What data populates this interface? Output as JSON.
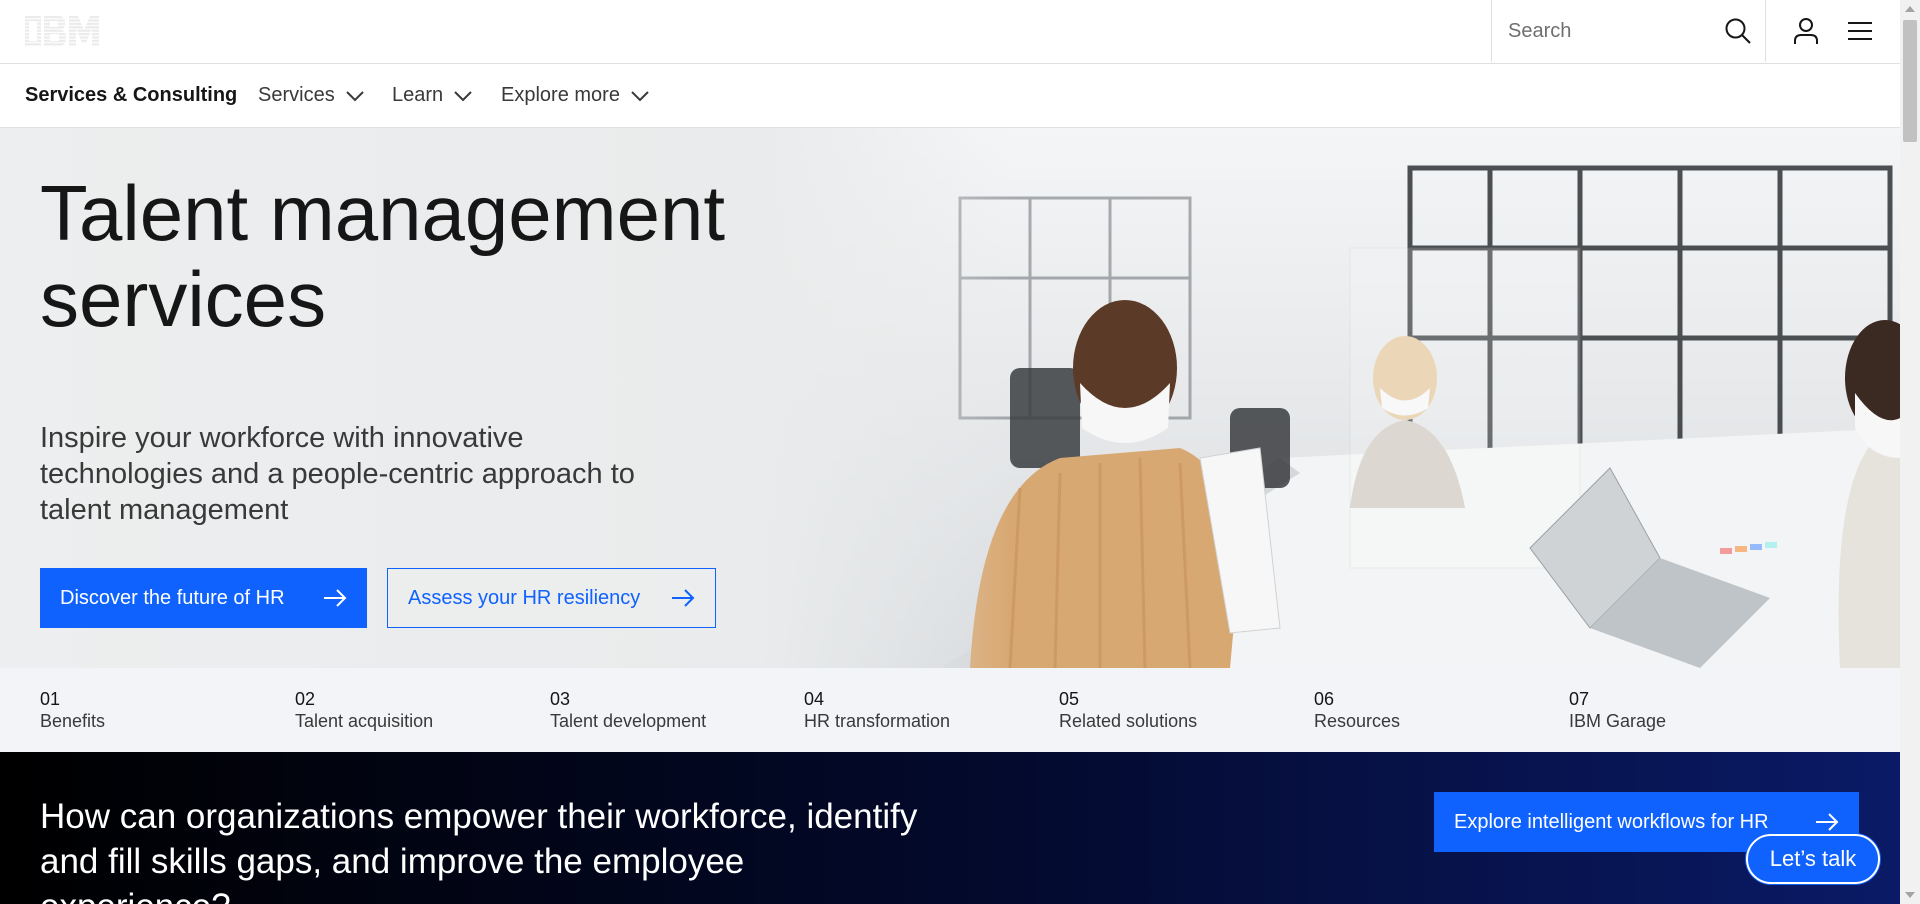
{
  "masthead": {
    "logo_text": "IBM",
    "search_placeholder": "Search",
    "icons": {
      "search": "search-icon",
      "user": "user-icon",
      "menu": "menu-icon"
    }
  },
  "nav": {
    "brand": "Services & Consulting",
    "items": [
      {
        "label": "Services"
      },
      {
        "label": "Learn"
      },
      {
        "label": "Explore more"
      }
    ]
  },
  "hero": {
    "title": "Talent management services",
    "subtitle": "Inspire your workforce with innovative technologies and a people-centric approach to talent management",
    "primary_cta": "Discover the future of HR",
    "secondary_cta": "Assess your HR resiliency"
  },
  "toc": [
    {
      "num": "01",
      "label": "Benefits"
    },
    {
      "num": "02",
      "label": "Talent acquisition"
    },
    {
      "num": "03",
      "label": "Talent development"
    },
    {
      "num": "04",
      "label": "HR transformation"
    },
    {
      "num": "05",
      "label": "Related solutions"
    },
    {
      "num": "06",
      "label": "Resources"
    },
    {
      "num": "07",
      "label": "IBM Garage"
    }
  ],
  "band": {
    "text": "How can organizations empower their workforce, identify and fill skills gaps, and improve the employee experience?",
    "cta": "Explore intelligent workflows for HR"
  },
  "chat": {
    "label": "Let’s talk"
  },
  "colors": {
    "accent": "#0f62fe",
    "text": "#161616",
    "toc_bg": "#f2f4f8",
    "band_bg": "#03092a"
  }
}
